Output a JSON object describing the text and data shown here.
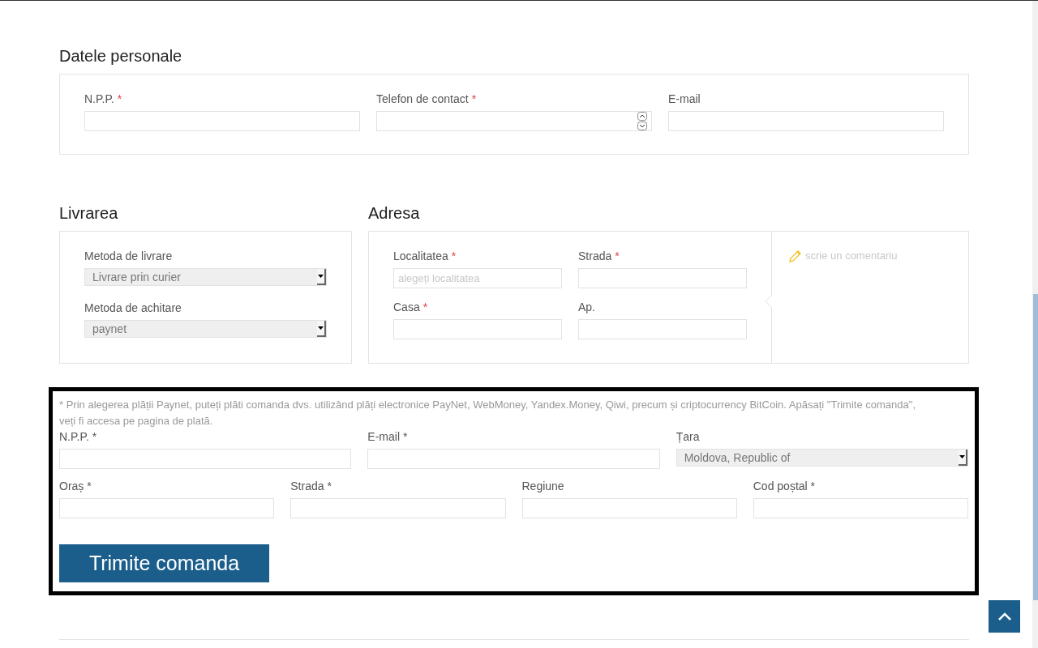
{
  "required_mark": "*",
  "personal": {
    "title": "Datele personale",
    "fields": [
      {
        "label": "N.P.P.",
        "required": true,
        "kind": "text"
      },
      {
        "label": "Telefon de contact",
        "required": true,
        "kind": "number"
      },
      {
        "label": "E-mail",
        "required": false,
        "kind": "text"
      }
    ]
  },
  "delivery": {
    "title": "Livrarea",
    "fields": [
      {
        "label": "Metoda de livrare",
        "value": "Livrare prin curier"
      },
      {
        "label": "Metoda de achitare",
        "value": "paynet"
      }
    ]
  },
  "address": {
    "title": "Adresa",
    "fields": [
      {
        "label": "Localitatea",
        "required": true,
        "placeholder": "alegeți localitatea"
      },
      {
        "label": "Strada",
        "required": true
      },
      {
        "label": "Casa",
        "required": true
      },
      {
        "label": "Ap.",
        "required": false
      }
    ],
    "comment": {
      "placeholder": "scrie un comentariu"
    }
  },
  "payment": {
    "note": "* Prin alegerea plății Paynet, puteți plăti comanda dvs. utilizând plăți electronice PayNet, WebMoney, Yandex.Money, Qiwi, precum și criptocurrency BitCoin. Apăsați \"Trimite comanda\", veți fi accesa pe pagina de plată.",
    "contact_fields": [
      {
        "label": "N.P.P. *",
        "kind": "text"
      },
      {
        "label": "E-mail *",
        "kind": "text"
      },
      {
        "label": "Țara",
        "kind": "select",
        "value": "Moldova, Republic of"
      }
    ],
    "address_fields": [
      {
        "label": "Oraș *",
        "kind": "text"
      },
      {
        "label": "Strada *",
        "kind": "text"
      },
      {
        "label": "Regiune",
        "kind": "text"
      },
      {
        "label": "Cod poștal *",
        "kind": "text"
      }
    ],
    "submit": "Trimite comanda"
  }
}
